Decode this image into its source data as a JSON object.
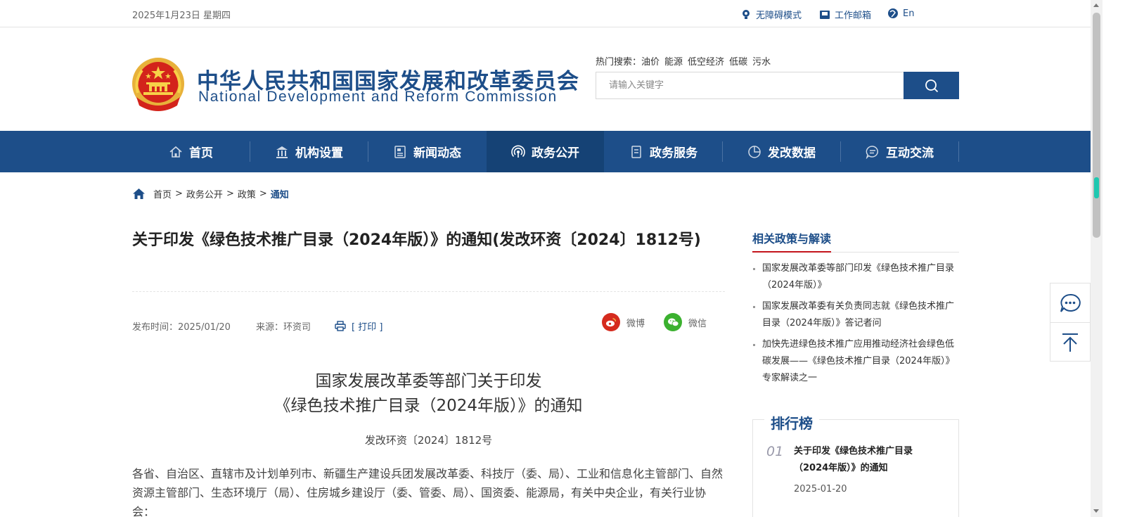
{
  "topbar": {
    "date": "2025年1月23日 星期四",
    "accessibility": "无障碍模式",
    "mail": "工作邮箱",
    "english": "En"
  },
  "header": {
    "title_cn": "中华人民共和国国家发展和改革委员会",
    "title_en": "National Development and Reform Commission",
    "hot_label": "热门搜索：",
    "hot_keywords": [
      "油价",
      "能源",
      "低空经济",
      "低碳",
      "污水"
    ],
    "search_placeholder": "请输入关键字"
  },
  "nav": {
    "items": [
      {
        "label": "首页",
        "icon": "home-icon"
      },
      {
        "label": "机构设置",
        "icon": "building-icon"
      },
      {
        "label": "新闻动态",
        "icon": "news-icon"
      },
      {
        "label": "政务公开",
        "icon": "broadcast-icon",
        "active": true
      },
      {
        "label": "政务服务",
        "icon": "document-icon"
      },
      {
        "label": "发改数据",
        "icon": "pie-chart-icon"
      },
      {
        "label": "互动交流",
        "icon": "chat-icon"
      }
    ]
  },
  "breadcrumb": {
    "items": [
      "首页",
      "政务公开",
      "政策",
      "通知"
    ],
    "separator": ">"
  },
  "article": {
    "title": "关于印发《绿色技术推广目录（2024年版）》的通知(发改环资〔2024〕1812号)",
    "publish_time": "发布时间：2025/01/20",
    "source": "来源：环资司",
    "print": "[ 打印 ]",
    "share_weibo": "微博",
    "share_wechat": "微信",
    "doc_heading_1": "国家发展改革委等部门关于印发",
    "doc_heading_2": "《绿色技术推广目录（2024年版）》的通知",
    "doc_number": "发改环资〔2024〕1812号",
    "body": "各省、自治区、直辖市及计划单列市、新疆生产建设兵团发展改革委、科技厅（委、局）、工业和信息化主管部门、自然资源主管部门、生态环境厅（局）、住房城乡建设厅（委、管委、局）、国资委、能源局，有关中央企业，有关行业协会："
  },
  "sidebar": {
    "related_title": "相关政策与解读",
    "related": [
      "国家发展改革委等部门印发《绿色技术推广目录（2024年版）》",
      "国家发展改革委有关负责同志就《绿色技术推广目录（2024年版）》答记者问",
      "加快先进绿色技术推广应用推动经济社会绿色低碳发展——《绿色技术推广目录（2024年版）》专家解读之一"
    ],
    "rank_title": "排行榜",
    "rank": [
      {
        "no": "01",
        "text": "关于印发《绿色技术推广目录（2024年版）》的通知",
        "date": "2025-01-20"
      }
    ]
  },
  "colors": {
    "brand": "#1d4e89",
    "nav_active": "#154275",
    "accent_red": "#c4151c",
    "weibo": "#d52b1e",
    "wechat": "#3bb12f"
  }
}
